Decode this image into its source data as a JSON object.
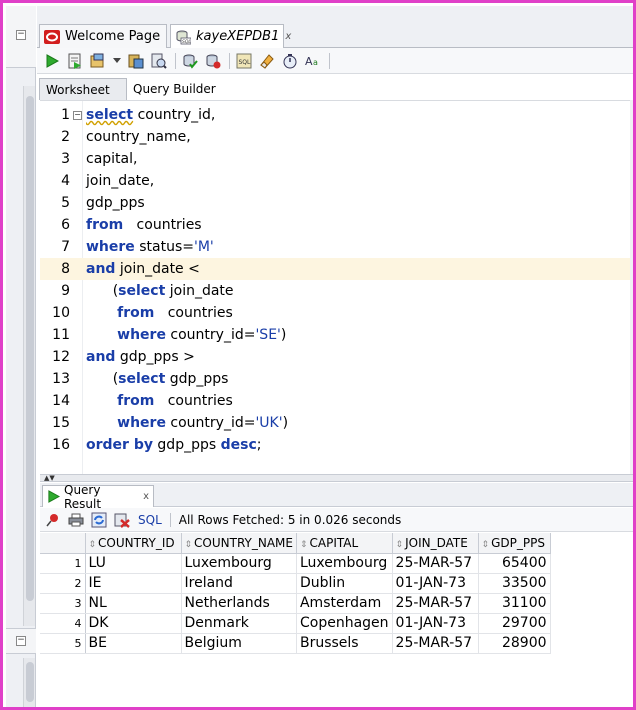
{
  "colors": {
    "frame_border": "#e040c8",
    "keyword": "#1a3ea8",
    "highlight_line": "#fdf5e0"
  },
  "doc_tabs": [
    {
      "label": "Welcome Page",
      "icon": "oracle-logo-icon"
    },
    {
      "label": "kayeXEPDB1",
      "icon": "sql-connection-icon",
      "close": "x"
    }
  ],
  "toolbar": {
    "icons": [
      "run-statement-icon",
      "run-script-icon",
      "autotrace-icon",
      "dropdown-icon",
      "explain-plan-icon",
      "sql-tuning-icon",
      "commit-icon",
      "rollback-icon",
      "sql-history-icon",
      "eraser-icon",
      "timer-icon",
      "format-icon"
    ]
  },
  "worksheet_tabs": [
    "Worksheet",
    "Query Builder"
  ],
  "editor": {
    "lines": [
      {
        "n": "1",
        "parts": [
          {
            "t": "select",
            "k": "kw squig"
          },
          {
            "t": " country_id,",
            "k": ""
          }
        ]
      },
      {
        "n": "2",
        "parts": [
          {
            "t": "country_name,",
            "k": ""
          }
        ]
      },
      {
        "n": "3",
        "parts": [
          {
            "t": "capital,",
            "k": ""
          }
        ]
      },
      {
        "n": "4",
        "parts": [
          {
            "t": "join_date,",
            "k": ""
          }
        ]
      },
      {
        "n": "5",
        "parts": [
          {
            "t": "gdp_pps",
            "k": ""
          }
        ]
      },
      {
        "n": "6",
        "parts": [
          {
            "t": "from",
            "k": "kw"
          },
          {
            "t": "   countries",
            "k": ""
          }
        ]
      },
      {
        "n": "7",
        "parts": [
          {
            "t": "where",
            "k": "kw"
          },
          {
            "t": " status=",
            "k": ""
          },
          {
            "t": "'M'",
            "k": "str"
          }
        ]
      },
      {
        "n": "8",
        "parts": [
          {
            "t": "and",
            "k": "kw"
          },
          {
            "t": " join_date <",
            "k": ""
          }
        ]
      },
      {
        "n": "9",
        "parts": [
          {
            "t": "      (",
            "k": ""
          },
          {
            "t": "select",
            "k": "kw"
          },
          {
            "t": " join_date",
            "k": ""
          }
        ]
      },
      {
        "n": "10",
        "parts": [
          {
            "t": "       ",
            "k": ""
          },
          {
            "t": "from",
            "k": "kw"
          },
          {
            "t": "   countries",
            "k": ""
          }
        ]
      },
      {
        "n": "11",
        "parts": [
          {
            "t": "       ",
            "k": ""
          },
          {
            "t": "where",
            "k": "kw"
          },
          {
            "t": " country_id=",
            "k": ""
          },
          {
            "t": "'SE'",
            "k": "str"
          },
          {
            "t": ")",
            "k": ""
          }
        ]
      },
      {
        "n": "12",
        "parts": [
          {
            "t": "and",
            "k": "kw"
          },
          {
            "t": " gdp_pps >",
            "k": ""
          }
        ]
      },
      {
        "n": "13",
        "parts": [
          {
            "t": "      (",
            "k": ""
          },
          {
            "t": "select",
            "k": "kw"
          },
          {
            "t": " gdp_pps",
            "k": ""
          }
        ]
      },
      {
        "n": "14",
        "parts": [
          {
            "t": "       ",
            "k": ""
          },
          {
            "t": "from",
            "k": "kw"
          },
          {
            "t": "   countries",
            "k": ""
          }
        ]
      },
      {
        "n": "15",
        "parts": [
          {
            "t": "       ",
            "k": ""
          },
          {
            "t": "where",
            "k": "kw"
          },
          {
            "t": " country_id=",
            "k": ""
          },
          {
            "t": "'UK'",
            "k": "str"
          },
          {
            "t": ")",
            "k": ""
          }
        ]
      },
      {
        "n": "16",
        "parts": [
          {
            "t": "order by",
            "k": "kw"
          },
          {
            "t": " gdp_pps ",
            "k": ""
          },
          {
            "t": "desc",
            "k": "kw"
          },
          {
            "t": ";",
            "k": ""
          }
        ]
      }
    ],
    "highlighted_line": "8"
  },
  "result_tab": {
    "label": "Query Result",
    "close": "x"
  },
  "result_toolbar": {
    "sql_label": "SQL",
    "status": "All Rows Fetched: 5 in 0.026 seconds"
  },
  "grid": {
    "columns": [
      "COUNTRY_ID",
      "COUNTRY_NAME",
      "CAPITAL",
      "JOIN_DATE",
      "GDP_PPS"
    ],
    "rows": [
      [
        "1",
        "LU",
        "Luxembourg",
        "Luxembourg",
        "25-MAR-57",
        "65400"
      ],
      [
        "2",
        "IE",
        "Ireland",
        "Dublin",
        "01-JAN-73",
        "33500"
      ],
      [
        "3",
        "NL",
        "Netherlands",
        "Amsterdam",
        "25-MAR-57",
        "31100"
      ],
      [
        "4",
        "DK",
        "Denmark",
        "Copenhagen",
        "01-JAN-73",
        "29700"
      ],
      [
        "5",
        "BE",
        "Belgium",
        "Brussels",
        "25-MAR-57",
        "28900"
      ]
    ]
  }
}
